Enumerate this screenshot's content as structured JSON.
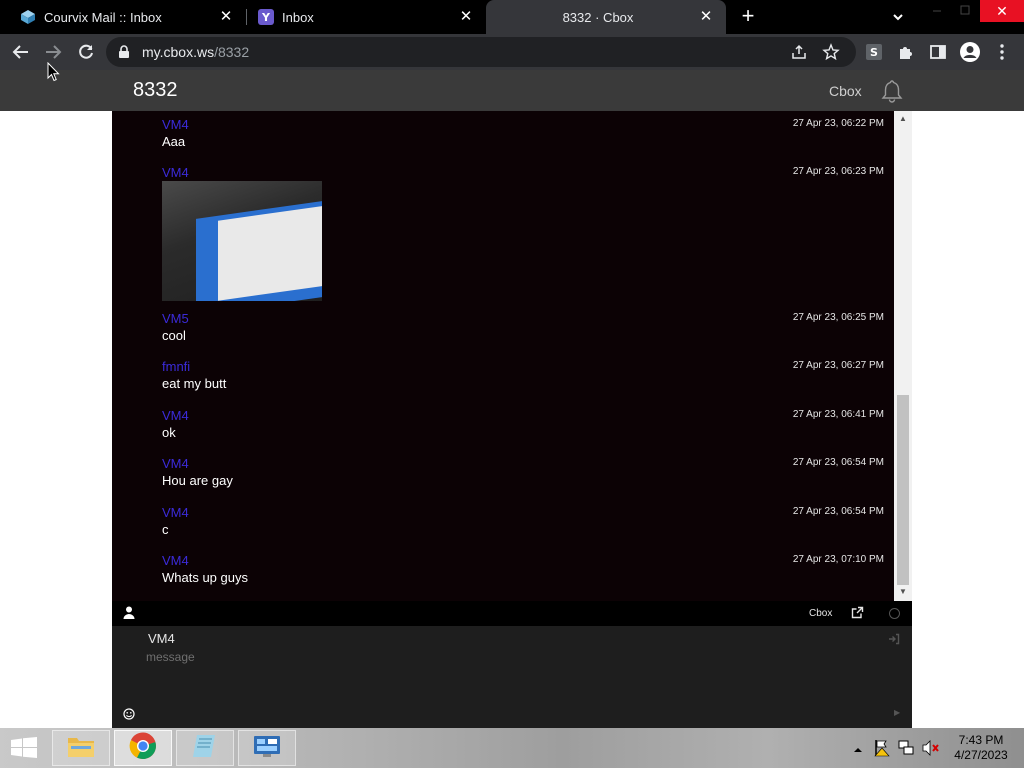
{
  "browser": {
    "tabs": [
      {
        "title": "Courvix Mail :: Inbox",
        "icon": "courvix-icon",
        "active": false
      },
      {
        "title": "Inbox",
        "icon": "yahoo-icon",
        "active": false
      },
      {
        "title": "8332 · Cbox",
        "icon": "none",
        "active": true
      }
    ],
    "url_host": "my.cbox.ws",
    "url_path": "/8332"
  },
  "site": {
    "title": "8332",
    "brand": "Cbox"
  },
  "messages": [
    {
      "author": "VM4",
      "time": "27 Apr 23, 06:22 PM",
      "text": "Aaa"
    },
    {
      "author": "VM4",
      "time": "27 Apr 23, 06:23 PM",
      "text": "",
      "image": true
    },
    {
      "author": "VM5",
      "time": "27 Apr 23, 06:25 PM",
      "text": "cool"
    },
    {
      "author": "fmnfi",
      "time": "27 Apr 23, 06:27 PM",
      "text": "eat my butt"
    },
    {
      "author": "VM4",
      "time": "27 Apr 23, 06:41 PM",
      "text": "ok"
    },
    {
      "author": "VM4",
      "time": "27 Apr 23, 06:54 PM",
      "text": "Hou are gay"
    },
    {
      "author": "VM4",
      "time": "27 Apr 23, 06:54 PM",
      "text": "c"
    },
    {
      "author": "VM4",
      "time": "27 Apr 23, 07:10 PM",
      "text": "Whats up guys"
    }
  ],
  "chatbar": {
    "brand": "Cbox"
  },
  "composer": {
    "name": "VM4",
    "placeholder": "message"
  },
  "taskbar": {
    "time": "7:43 PM",
    "date": "4/27/2023"
  },
  "colors": {
    "chat_bg": "#0c0205",
    "author": "#3b2bd9",
    "close_red": "#e81123"
  }
}
